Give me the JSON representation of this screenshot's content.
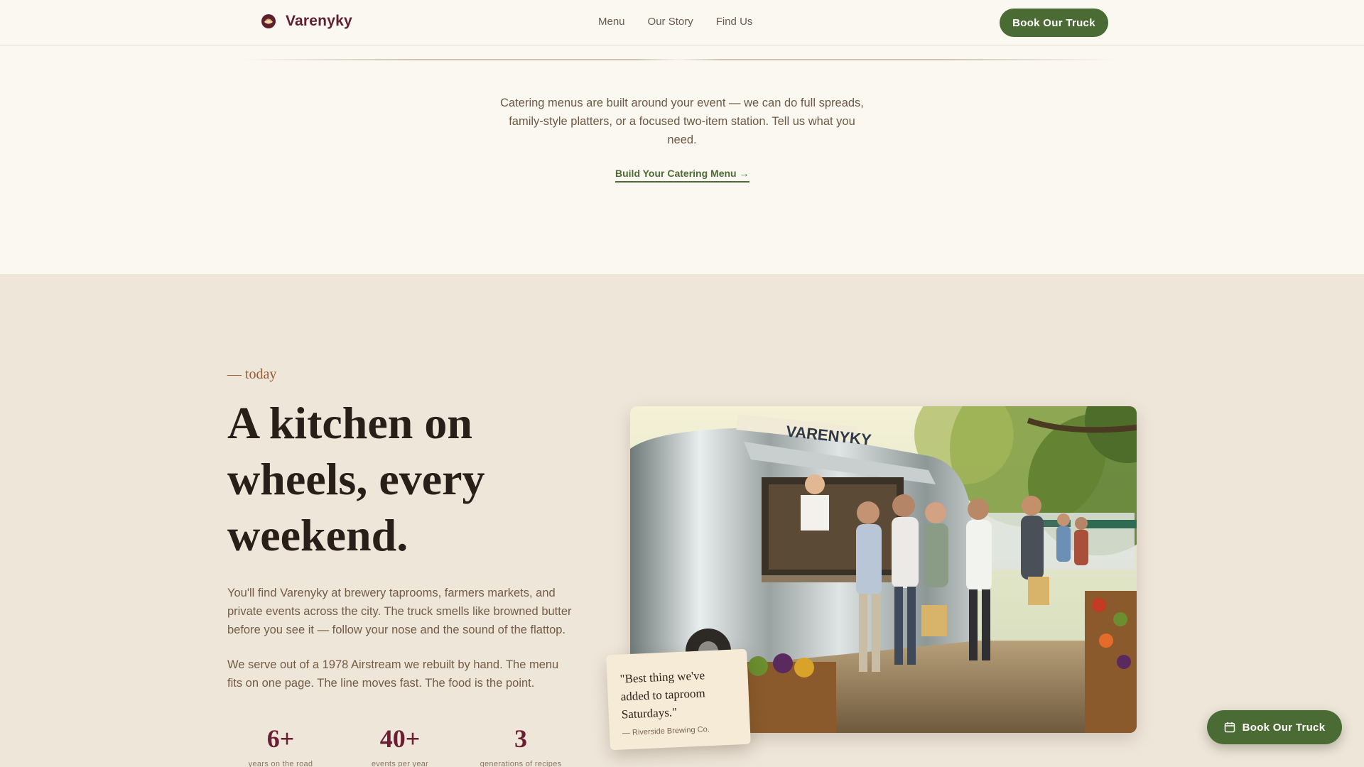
{
  "brand": {
    "name": "Varenyky",
    "logo_icon": "dumpling-logo-icon"
  },
  "nav": {
    "links": [
      "Menu",
      "Our Story",
      "Find Us"
    ],
    "cta_label": "Book Our Truck"
  },
  "catering": {
    "text": "Catering menus are built around your event — we can do full spreads, family-style platters, or a focused two-item station. Tell us what you need.",
    "link_label": "Build Your Catering Menu →"
  },
  "today": {
    "eyebrow": "— today",
    "headline": "A kitchen on wheels, every weekend.",
    "paragraph_1": "You'll find Varenyky at brewery taprooms, farmers markets, and private events across the city. The truck smells like browned butter before you see it — follow your nose and the sound of the flattop.",
    "paragraph_2": "We serve out of a 1978 Airstream we rebuilt by hand. The menu fits on one page. The line moves fast. The food is the point.",
    "stats": [
      {
        "value": "6+",
        "label": "years on the road"
      },
      {
        "value": "40+",
        "label": "events per year"
      },
      {
        "value": "3",
        "label": "generations of recipes"
      }
    ],
    "photo_sign": "VARENYKY",
    "quote": {
      "text": "\"Best thing we've added to taproom Saturdays.\"",
      "source": "— Riverside Brewing Co."
    }
  },
  "floating_cta": {
    "label": "Book Our Truck",
    "icon": "calendar-icon"
  },
  "colors": {
    "background": "#fbf8f2",
    "section_alt": "#efe6da",
    "brand": "#5e1f2f",
    "accent_green": "#4a6b34",
    "stat_color": "#6a1f34"
  }
}
